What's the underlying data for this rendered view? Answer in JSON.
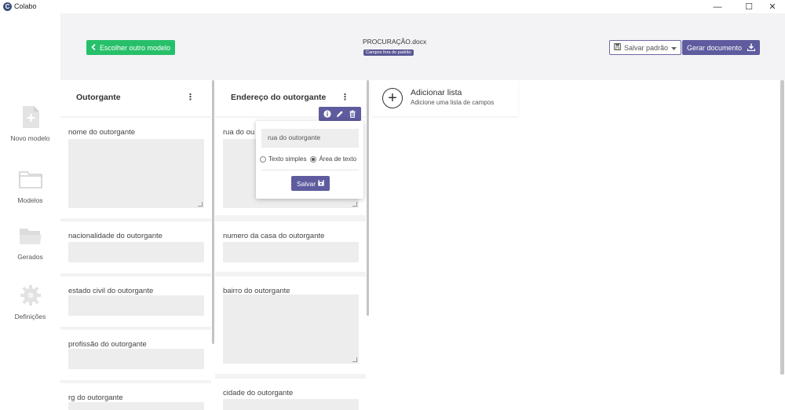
{
  "window": {
    "title": "Colabo",
    "logo_letter": "C",
    "minimize": "—",
    "maximize": "☐",
    "close": "✕"
  },
  "sidebar": {
    "items": [
      {
        "label": "Novo modelo",
        "icon": "new-document-icon"
      },
      {
        "label": "Modelos",
        "icon": "folder-icon"
      },
      {
        "label": "Gerados",
        "icon": "folder-open-icon"
      },
      {
        "label": "Definições",
        "icon": "gear-icon"
      }
    ]
  },
  "header": {
    "back_button": "Escolher outro modelo",
    "doc_name": "PROCURAÇÃO.docx",
    "doc_badge": "Campos fora do padrão",
    "save_default_button": "Salvar padrão",
    "generate_button": "Gerar documento"
  },
  "columns": [
    {
      "title": "Outorgante",
      "fields": [
        {
          "label": "nome do outorgante",
          "type": "textarea"
        },
        {
          "label": "nacionalidade do outorgante",
          "type": "text"
        },
        {
          "label": "estado civil do outorgante",
          "type": "text"
        },
        {
          "label": "profissão do outorgante",
          "type": "text"
        },
        {
          "label": "rg do outorgante",
          "type": "text"
        }
      ]
    },
    {
      "title": "Endereço do outorgante",
      "fields": [
        {
          "label": "rua do ou",
          "type": "textarea"
        },
        {
          "label": "numero da casa do outorgante",
          "type": "text"
        },
        {
          "label": "bairro do outorgante",
          "type": "textarea"
        },
        {
          "label": "cidade do outorgante",
          "type": "text"
        }
      ]
    }
  ],
  "add_list": {
    "title": "Adicionar lista",
    "subtitle": "Adicione uma lista de campos"
  },
  "popup": {
    "input_value": "rua do outorgante",
    "option_simple": "Texto simples",
    "option_area": "Área de texto",
    "selected": "Área de texto",
    "save_button": "Salvar"
  },
  "colors": {
    "accent": "#5e5b9e",
    "green": "#27c06a"
  }
}
